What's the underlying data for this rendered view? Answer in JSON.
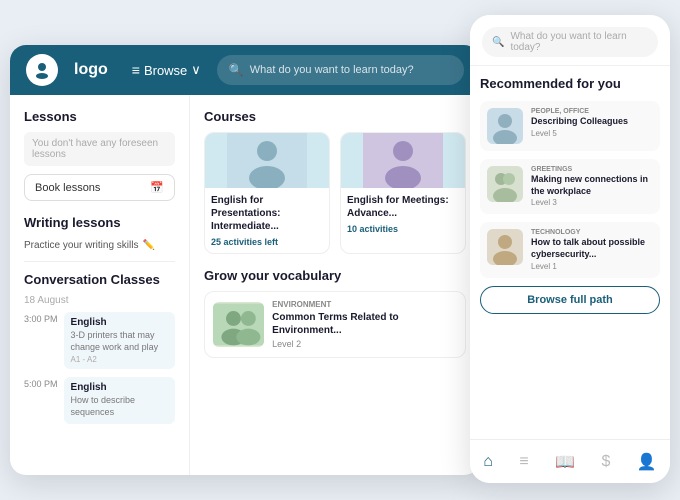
{
  "nav": {
    "logo": "logo",
    "browse": "Browse",
    "search_placeholder": "What do you want to learn today?"
  },
  "sidebar": {
    "lessons_title": "Lessons",
    "lessons_placeholder": "You don't have any foreseen lessons",
    "book_btn": "Book lessons",
    "writing_title": "Writing lessons",
    "writing_sub": "Practice your writing skills",
    "conv_title": "Conversation Classes",
    "date": "18 August",
    "classes": [
      {
        "time": "3:00 PM",
        "title": "English",
        "desc": "3-D printers that may change work and play",
        "level": "A1 - A2"
      },
      {
        "time": "5:00 PM",
        "title": "English",
        "desc": "How to describe sequences",
        "level": ""
      }
    ]
  },
  "courses": {
    "title": "Courses",
    "items": [
      {
        "name": "English for Presentations: Intermediate...",
        "activities": "25 activities left"
      },
      {
        "name": "English for Meetings: Advance...",
        "activities": "10 activities"
      }
    ]
  },
  "vocabulary": {
    "title": "Grow your vocabulary",
    "tag": "ENVIRONMENT",
    "name": "Common Terms Related to Environment...",
    "level": "Level 2"
  },
  "mobile": {
    "search_placeholder": "What do you want to learn today?",
    "rec_title": "Recommended for you",
    "recommendations": [
      {
        "tag": "PEOPLE, OFFICE",
        "name": "Describing Colleagues",
        "level": "Level 5"
      },
      {
        "tag": "GREETINGS",
        "name": "Making new connections in the workplace",
        "level": "Level 3"
      },
      {
        "tag": "TECHNOLOGY",
        "name": "How to talk about possible cybersecurity...",
        "level": "Level 1"
      }
    ],
    "browse_btn": "Browse full path"
  }
}
